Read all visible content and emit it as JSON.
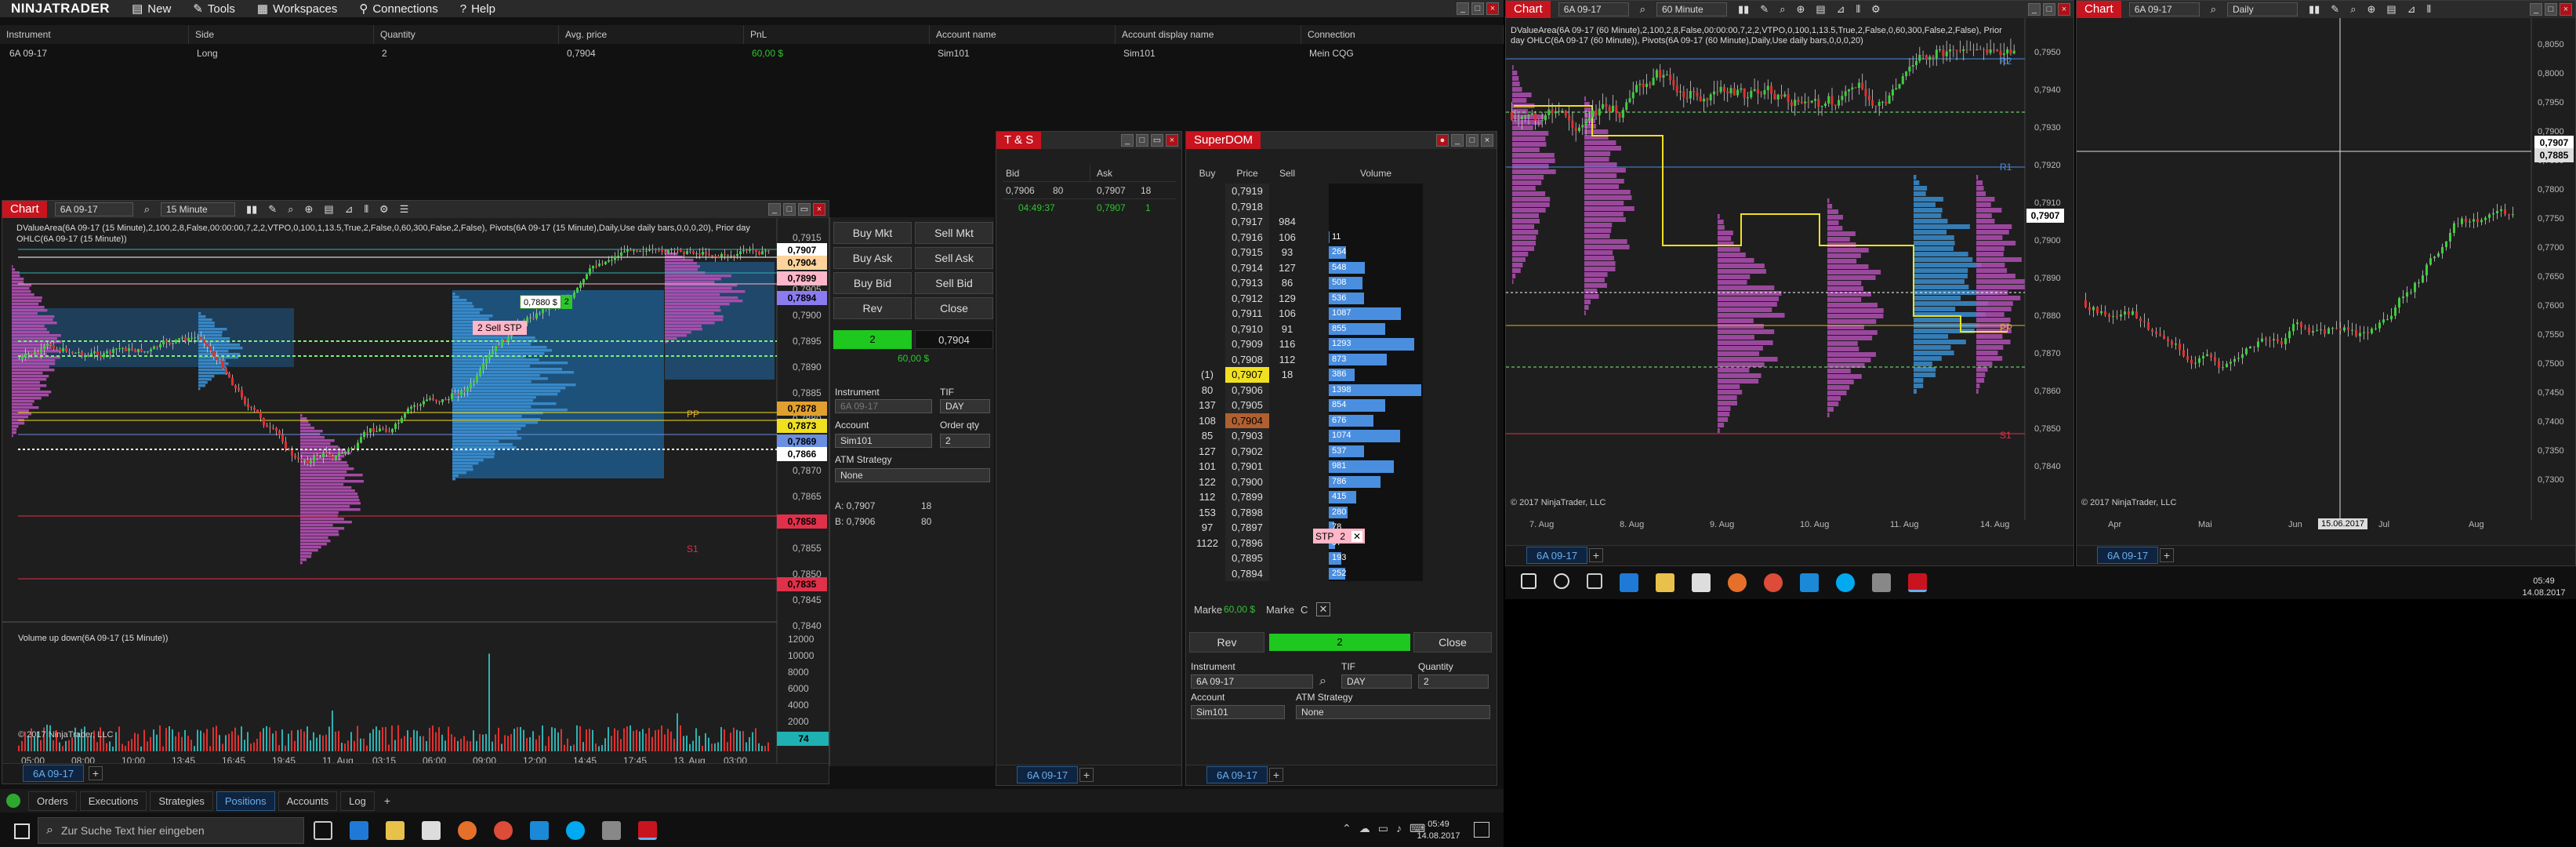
{
  "cc": {
    "logo": "NINJATRADER",
    "menu": [
      "New",
      "Tools",
      "Workspaces",
      "Connections",
      "Help"
    ],
    "positions_headers": [
      "Instrument",
      "Side",
      "Quantity",
      "Avg. price",
      "PnL",
      "Account name",
      "Account display name",
      "Connection"
    ],
    "positions_row": [
      "6A 09-17",
      "Long",
      "2",
      "0,7904",
      "60,00 $",
      "Sim101",
      "Sim101",
      "Mein CQG"
    ],
    "bottom_tabs": [
      "Orders",
      "Executions",
      "Strategies",
      "Positions",
      "Accounts",
      "Log"
    ],
    "active_bottom_tab": "Positions"
  },
  "chart1": {
    "title": "Chart",
    "instrument": "6A 09-17",
    "interval": "15 Minute",
    "indicator_text": "DValueArea(6A 09-17 (15 Minute),2,100,2,8,False,00:00:00,7,2,2,VTPO,0,100,1,13.5,True,2,False,0,60,300,False,2,False), Pivots(6A 09-17 (15 Minute),Daily,Use daily bars,0,0,0,20), Prior day OHLC(6A 09-17 (15 Minute))",
    "volume_label": "Volume up down(6A 09-17 (15 Minute))",
    "copyright": "© 2017 NinjaTrader, LLC",
    "sell_stp_label": "2  Sell STP",
    "sell_stp_qty": "0,7880 $",
    "pp_label": "PP",
    "s1_label": "S1",
    "price_axis": [
      "0,7915",
      "0,7910",
      "0,7905",
      "0,7900",
      "0,7895",
      "0,7890",
      "0,7885",
      "0,7880",
      "0,7875",
      "0,7870",
      "0,7865",
      "0,7860",
      "0,7855",
      "0,7850",
      "0,7845",
      "0,7840"
    ],
    "price_tags": [
      {
        "text": "0,7907",
        "color": "#ffffff"
      },
      {
        "text": "0,7904",
        "color": "#ffd39b"
      },
      {
        "text": "0,7899",
        "color": "#ffb6c8"
      },
      {
        "text": "0,7894",
        "color": "#8a7cf0"
      },
      {
        "text": "0,7878",
        "color": "#e0a030"
      },
      {
        "text": "0,7873",
        "color": "#f0e020"
      },
      {
        "text": "0,7869",
        "color": "#6a8ee0"
      },
      {
        "text": "0,7866",
        "color": "#ffffff"
      },
      {
        "text": "0,7858",
        "color": "#e0304a"
      },
      {
        "text": "0,7835",
        "color": "#e0304a"
      }
    ],
    "vol_axis": [
      "12000",
      "10000",
      "8000",
      "6000",
      "4000",
      "2000"
    ],
    "vol_tag": "74",
    "time_axis": [
      "05:00",
      "08:00",
      "10:00",
      "13:45",
      "16:45",
      "19:45",
      "11. Aug",
      "03:15",
      "06:00",
      "09:00",
      "12:00",
      "14:45",
      "17:45",
      "13. Aug",
      "03:00"
    ],
    "tab": "6A 09-17"
  },
  "chart_trader": {
    "buy_mkt": "Buy Mkt",
    "sell_mkt": "Sell Mkt",
    "buy_ask": "Buy Ask",
    "sell_ask": "Sell Ask",
    "buy_bid": "Buy Bid",
    "sell_bid": "Sell Bid",
    "rev": "Rev",
    "close": "Close",
    "position_qty": "2",
    "position_price": "0,7904",
    "pnl": "60,00 $",
    "instrument_label": "Instrument",
    "instrument": "6A 09-17",
    "tif_label": "TIF",
    "tif": "DAY",
    "account_label": "Account",
    "account": "Sim101",
    "order_qty_label": "Order qty",
    "order_qty": "2",
    "atm_label": "ATM Strategy",
    "atm": "None",
    "ask_line": "A:  0,7907",
    "ask_size": "18",
    "bid_line": "B:  0,7906",
    "bid_size": "80"
  },
  "ts": {
    "title": "T & S",
    "headers": [
      "Bid",
      "Ask"
    ],
    "bid_price": "0,7906",
    "bid_size": "80",
    "ask_price": "0,7907",
    "ask_size": "18",
    "trade_time": "04:49:37",
    "trade_price": "0,7907",
    "trade_size": "1",
    "tab": "6A 09-17"
  },
  "dom": {
    "title": "SuperDOM",
    "headers": [
      "Buy",
      "Price",
      "Sell",
      "Volume"
    ],
    "rows": [
      {
        "buy": "",
        "price": "0,7919",
        "sell": "",
        "vol": ""
      },
      {
        "buy": "",
        "price": "0,7918",
        "sell": "",
        "vol": ""
      },
      {
        "buy": "",
        "price": "0,7917",
        "sell": "984",
        "vol": ""
      },
      {
        "buy": "",
        "price": "0,7916",
        "sell": "106",
        "vol": "11"
      },
      {
        "buy": "",
        "price": "0,7915",
        "sell": "93",
        "vol": "264"
      },
      {
        "buy": "",
        "price": "0,7914",
        "sell": "127",
        "vol": "548"
      },
      {
        "buy": "",
        "price": "0,7913",
        "sell": "86",
        "vol": "508"
      },
      {
        "buy": "",
        "price": "0,7912",
        "sell": "129",
        "vol": "536"
      },
      {
        "buy": "",
        "price": "0,7911",
        "sell": "106",
        "vol": "1087"
      },
      {
        "buy": "",
        "price": "0,7910",
        "sell": "91",
        "vol": "855"
      },
      {
        "buy": "",
        "price": "0,7909",
        "sell": "116",
        "vol": "1293"
      },
      {
        "buy": "",
        "price": "0,7908",
        "sell": "112",
        "vol": "873"
      },
      {
        "buy": "(1)",
        "price": "0,7907",
        "sell": "18",
        "vol": "386"
      },
      {
        "buy": "80",
        "price": "0,7906",
        "sell": "",
        "vol": "1398"
      },
      {
        "buy": "137",
        "price": "0,7905",
        "sell": "",
        "vol": "854"
      },
      {
        "buy": "108",
        "price": "0,7904",
        "sell": "",
        "vol": "676"
      },
      {
        "buy": "85",
        "price": "0,7903",
        "sell": "",
        "vol": "1074"
      },
      {
        "buy": "127",
        "price": "0,7902",
        "sell": "",
        "vol": "537"
      },
      {
        "buy": "101",
        "price": "0,7901",
        "sell": "",
        "vol": "981"
      },
      {
        "buy": "122",
        "price": "0,7900",
        "sell": "",
        "vol": "786"
      },
      {
        "buy": "112",
        "price": "0,7899",
        "sell": "",
        "vol": "415"
      },
      {
        "buy": "153",
        "price": "0,7898",
        "sell": "",
        "vol": "280"
      },
      {
        "buy": "97",
        "price": "0,7897",
        "sell": "",
        "vol": "78"
      },
      {
        "buy": "1122",
        "price": "0,7896",
        "sell": "",
        "vol": "97"
      },
      {
        "buy": "",
        "price": "0,7895",
        "sell": "",
        "vol": "193"
      },
      {
        "buy": "",
        "price": "0,7894",
        "sell": "",
        "vol": "252"
      }
    ],
    "stp_label": "STP",
    "stp_qty": "2",
    "market_left": "Marke",
    "market_pnl": "60,00 $",
    "market_right": "Marke",
    "market_c": "C",
    "rev": "Rev",
    "position_qty": "2",
    "close": "Close",
    "instrument_label": "Instrument",
    "instrument": "6A 09-17",
    "tif_label": "TIF",
    "tif": "DAY",
    "qty_label": "Quantity",
    "qty": "2",
    "account_label": "Account",
    "account": "Sim101",
    "atm_label": "ATM Strategy",
    "atm": "None",
    "tab": "6A 09-17"
  },
  "chart2": {
    "title": "Chart",
    "instrument": "6A 09-17",
    "interval": "60 Minute",
    "indicator_text": "DValueArea(6A 09-17 (60 Minute),2,100,2,8,False,00:00:00,7,2,2,VTPO,0,100,1,13.5,True,2,False,0,60,300,False,2,False), Prior day OHLC(6A 09-17 (60 Minute)), Pivots(6A 09-17 (60 Minute),Daily,Use daily bars,0,0,0,20)",
    "copyright": "© 2017 NinjaTrader, LLC",
    "price_axis": [
      "0,7950",
      "0,7940",
      "0,7930",
      "0,7920",
      "0,7910",
      "0,7900",
      "0,7890",
      "0,7880",
      "0,7870",
      "0,7860",
      "0,7850",
      "0,7840"
    ],
    "price_tag": "0,7907",
    "labels": {
      "r2": "R2",
      "r1": "R1",
      "pp": "PP",
      "s1": "S1"
    },
    "time_axis": [
      "7. Aug",
      "8. Aug",
      "9. Aug",
      "10. Aug",
      "11. Aug",
      "14. Aug"
    ],
    "tab": "6A 09-17"
  },
  "chart3": {
    "title": "Chart",
    "instrument": "6A 09-17",
    "interval": "Daily",
    "copyright": "© 2017 NinjaTrader, LLC",
    "price_axis": [
      "0,8050",
      "0,8000",
      "0,7950",
      "0,7900",
      "0,7850",
      "0,7800",
      "0,7750",
      "0,7700",
      "0,7650",
      "0,7600",
      "0,7550",
      "0,7500",
      "0,7450",
      "0,7400",
      "0,7350",
      "0,7300"
    ],
    "price_tag_1": "0,7907",
    "price_tag_2": "0,7885",
    "time_axis": [
      "Apr",
      "Mai",
      "Jun",
      "Jul",
      "Aug"
    ],
    "crosshair_date": "15.06.2017",
    "tab": "6A 09-17"
  },
  "taskbar_left": {
    "search_placeholder": "Zur Suche Text hier eingeben",
    "time": "05:49",
    "date": "14.08.2017"
  },
  "taskbar_right": {
    "time": "05:49",
    "date": "14.08.2017"
  }
}
